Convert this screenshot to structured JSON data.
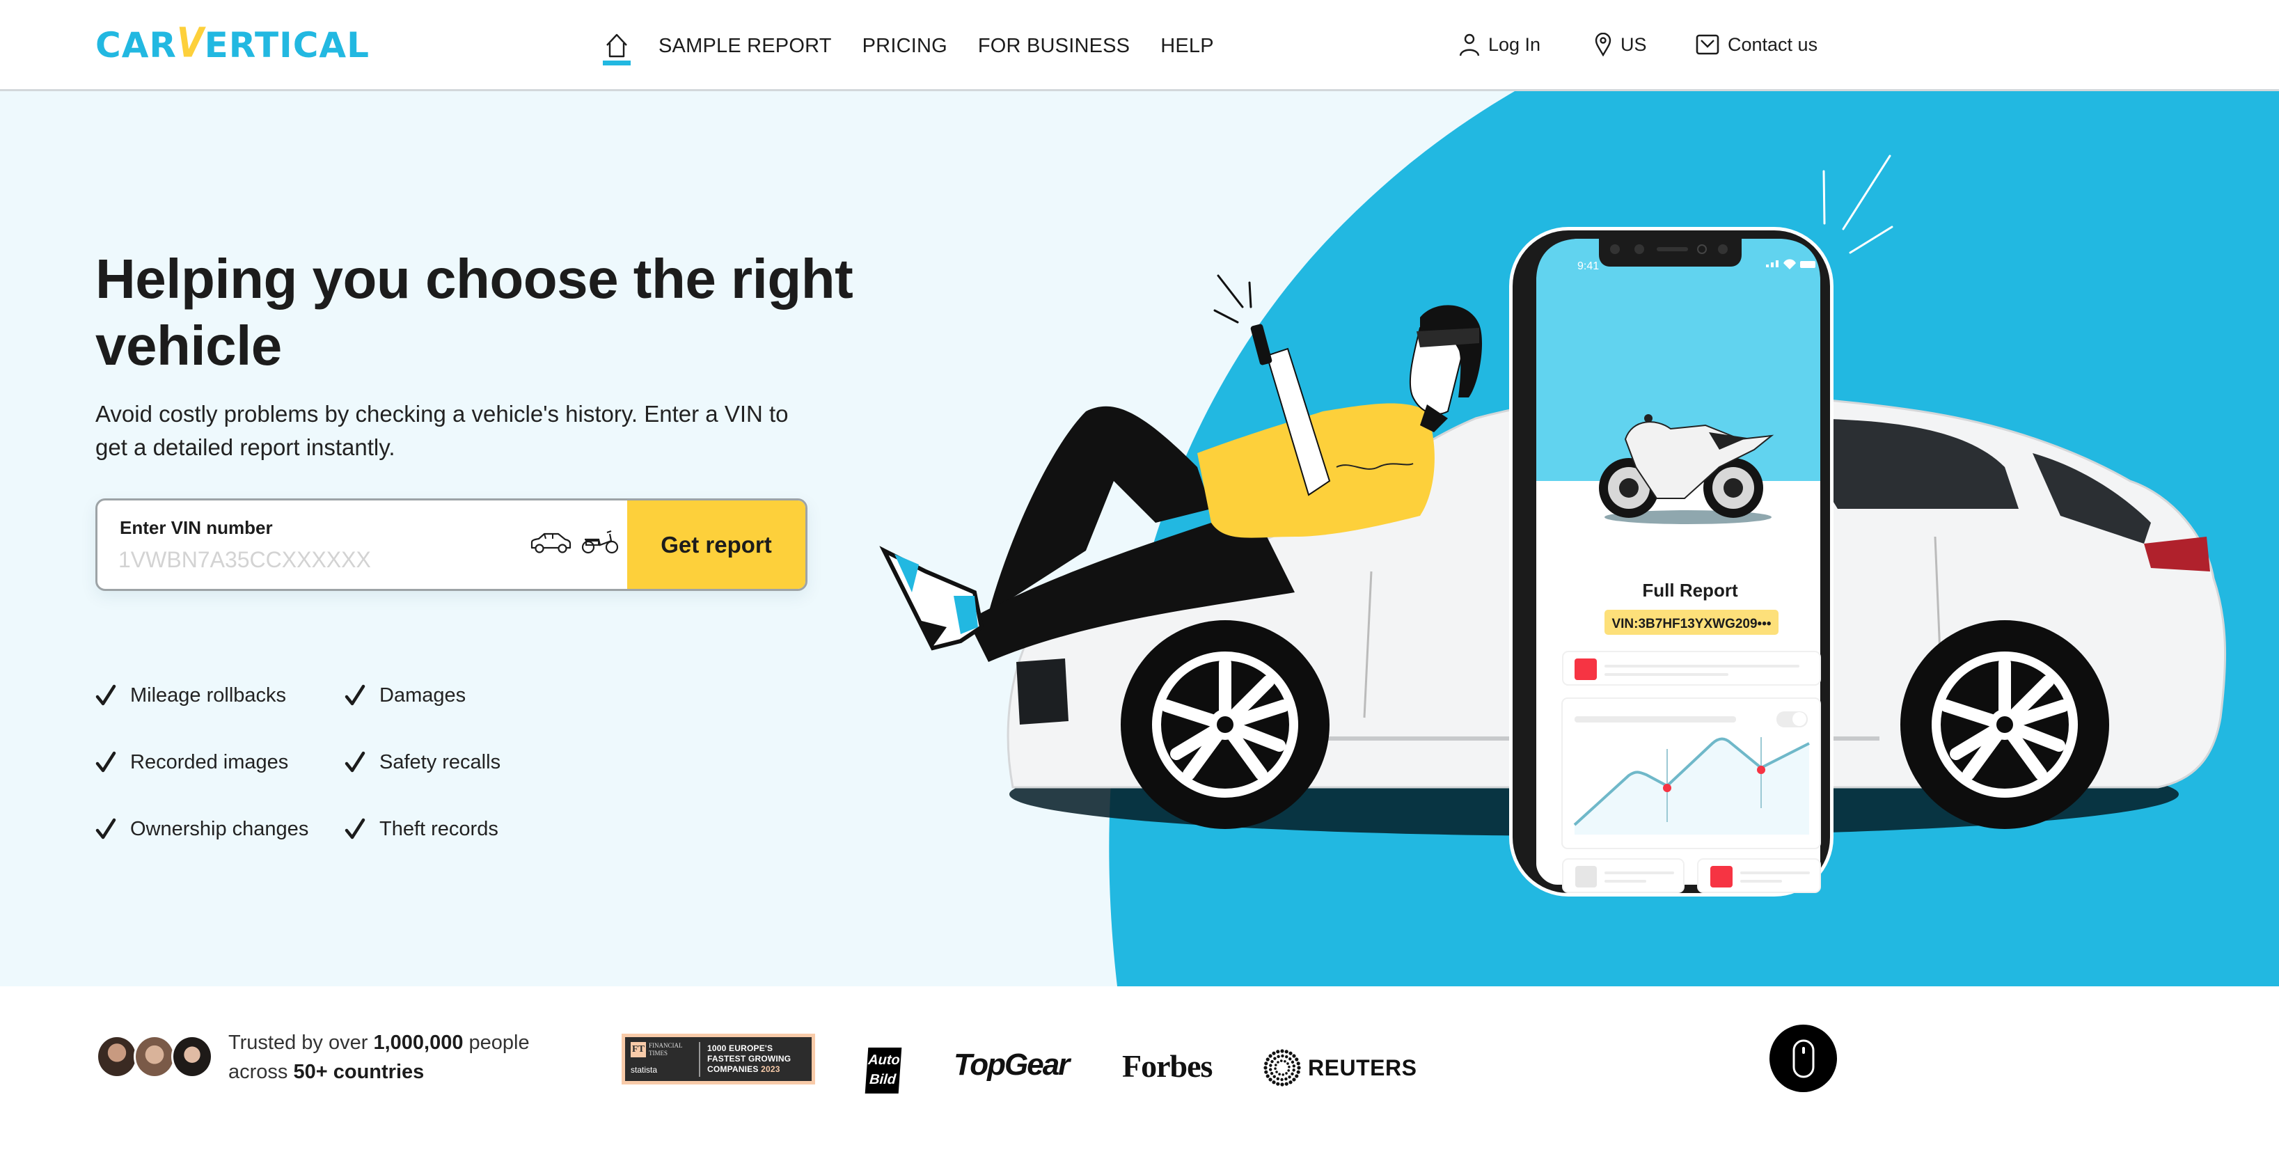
{
  "header": {
    "logo": {
      "part1": "CAR",
      "part2": "V",
      "part3": "ERTICAL"
    },
    "nav": [
      {
        "label": "SAMPLE REPORT"
      },
      {
        "label": "PRICING"
      },
      {
        "label": "FOR BUSINESS"
      },
      {
        "label": "HELP"
      }
    ],
    "home_icon": "home-icon",
    "login_label": "Log In",
    "region_label": "US",
    "contact_label": "Contact us"
  },
  "hero": {
    "headline": "Helping you choose the right vehicle",
    "subtitle": "Avoid costly problems by checking a vehicle's history. Enter a VIN to get a detailed report instantly.",
    "vin_label": "Enter VIN number",
    "vin_value": "",
    "vin_placeholder": "1VWBN7A35CCXXXXXX",
    "get_report_label": "Get report",
    "features": [
      {
        "label": "Mileage rollbacks"
      },
      {
        "label": "Damages"
      },
      {
        "label": "Recorded images"
      },
      {
        "label": "Safety recalls"
      },
      {
        "label": "Ownership changes"
      },
      {
        "label": "Theft records"
      }
    ]
  },
  "phone": {
    "time": "9:41",
    "report_title": "Full Report",
    "vin_badge": "VIN:3B7HF13YXWG209•••"
  },
  "trust": {
    "prefix": "Trusted by over ",
    "count": "1,000,000",
    "middle": " people",
    "line2_prefix": "across ",
    "countries": "50+ countries",
    "ft_badge": {
      "ft": "FT",
      "ft_name_1": "FINANCIAL",
      "ft_name_2": "TIMES",
      "statista": "statista",
      "line1": "1000 EUROPE'S",
      "line2": "FASTEST GROWING",
      "line3": "COMPANIES",
      "year": "2023"
    },
    "press": {
      "autobild_1": "Auto",
      "autobild_2": "Bild",
      "topgear": "TopGear",
      "forbes": "Forbes",
      "reuters": "REUTERS"
    }
  },
  "colors": {
    "brand_blue": "#22b8e1",
    "brand_yellow": "#fdd03b",
    "hero_bg": "#eef9fd",
    "text": "#1c1c1c",
    "alert_red": "#f63443"
  }
}
